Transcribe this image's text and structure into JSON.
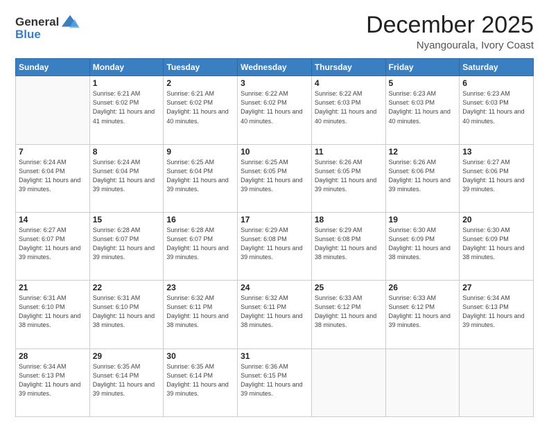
{
  "logo": {
    "general": "General",
    "blue": "Blue"
  },
  "header": {
    "month": "December 2025",
    "location": "Nyangourala, Ivory Coast"
  },
  "weekdays": [
    "Sunday",
    "Monday",
    "Tuesday",
    "Wednesday",
    "Thursday",
    "Friday",
    "Saturday"
  ],
  "weeks": [
    [
      {
        "day": "",
        "info": ""
      },
      {
        "day": "1",
        "info": "Sunrise: 6:21 AM\nSunset: 6:02 PM\nDaylight: 11 hours\nand 41 minutes."
      },
      {
        "day": "2",
        "info": "Sunrise: 6:21 AM\nSunset: 6:02 PM\nDaylight: 11 hours\nand 40 minutes."
      },
      {
        "day": "3",
        "info": "Sunrise: 6:22 AM\nSunset: 6:02 PM\nDaylight: 11 hours\nand 40 minutes."
      },
      {
        "day": "4",
        "info": "Sunrise: 6:22 AM\nSunset: 6:03 PM\nDaylight: 11 hours\nand 40 minutes."
      },
      {
        "day": "5",
        "info": "Sunrise: 6:23 AM\nSunset: 6:03 PM\nDaylight: 11 hours\nand 40 minutes."
      },
      {
        "day": "6",
        "info": "Sunrise: 6:23 AM\nSunset: 6:03 PM\nDaylight: 11 hours\nand 40 minutes."
      }
    ],
    [
      {
        "day": "7",
        "info": "Sunrise: 6:24 AM\nSunset: 6:04 PM\nDaylight: 11 hours\nand 39 minutes."
      },
      {
        "day": "8",
        "info": "Sunrise: 6:24 AM\nSunset: 6:04 PM\nDaylight: 11 hours\nand 39 minutes."
      },
      {
        "day": "9",
        "info": "Sunrise: 6:25 AM\nSunset: 6:04 PM\nDaylight: 11 hours\nand 39 minutes."
      },
      {
        "day": "10",
        "info": "Sunrise: 6:25 AM\nSunset: 6:05 PM\nDaylight: 11 hours\nand 39 minutes."
      },
      {
        "day": "11",
        "info": "Sunrise: 6:26 AM\nSunset: 6:05 PM\nDaylight: 11 hours\nand 39 minutes."
      },
      {
        "day": "12",
        "info": "Sunrise: 6:26 AM\nSunset: 6:06 PM\nDaylight: 11 hours\nand 39 minutes."
      },
      {
        "day": "13",
        "info": "Sunrise: 6:27 AM\nSunset: 6:06 PM\nDaylight: 11 hours\nand 39 minutes."
      }
    ],
    [
      {
        "day": "14",
        "info": "Sunrise: 6:27 AM\nSunset: 6:07 PM\nDaylight: 11 hours\nand 39 minutes."
      },
      {
        "day": "15",
        "info": "Sunrise: 6:28 AM\nSunset: 6:07 PM\nDaylight: 11 hours\nand 39 minutes."
      },
      {
        "day": "16",
        "info": "Sunrise: 6:28 AM\nSunset: 6:07 PM\nDaylight: 11 hours\nand 39 minutes."
      },
      {
        "day": "17",
        "info": "Sunrise: 6:29 AM\nSunset: 6:08 PM\nDaylight: 11 hours\nand 39 minutes."
      },
      {
        "day": "18",
        "info": "Sunrise: 6:29 AM\nSunset: 6:08 PM\nDaylight: 11 hours\nand 38 minutes."
      },
      {
        "day": "19",
        "info": "Sunrise: 6:30 AM\nSunset: 6:09 PM\nDaylight: 11 hours\nand 38 minutes."
      },
      {
        "day": "20",
        "info": "Sunrise: 6:30 AM\nSunset: 6:09 PM\nDaylight: 11 hours\nand 38 minutes."
      }
    ],
    [
      {
        "day": "21",
        "info": "Sunrise: 6:31 AM\nSunset: 6:10 PM\nDaylight: 11 hours\nand 38 minutes."
      },
      {
        "day": "22",
        "info": "Sunrise: 6:31 AM\nSunset: 6:10 PM\nDaylight: 11 hours\nand 38 minutes."
      },
      {
        "day": "23",
        "info": "Sunrise: 6:32 AM\nSunset: 6:11 PM\nDaylight: 11 hours\nand 38 minutes."
      },
      {
        "day": "24",
        "info": "Sunrise: 6:32 AM\nSunset: 6:11 PM\nDaylight: 11 hours\nand 38 minutes."
      },
      {
        "day": "25",
        "info": "Sunrise: 6:33 AM\nSunset: 6:12 PM\nDaylight: 11 hours\nand 38 minutes."
      },
      {
        "day": "26",
        "info": "Sunrise: 6:33 AM\nSunset: 6:12 PM\nDaylight: 11 hours\nand 39 minutes."
      },
      {
        "day": "27",
        "info": "Sunrise: 6:34 AM\nSunset: 6:13 PM\nDaylight: 11 hours\nand 39 minutes."
      }
    ],
    [
      {
        "day": "28",
        "info": "Sunrise: 6:34 AM\nSunset: 6:13 PM\nDaylight: 11 hours\nand 39 minutes."
      },
      {
        "day": "29",
        "info": "Sunrise: 6:35 AM\nSunset: 6:14 PM\nDaylight: 11 hours\nand 39 minutes."
      },
      {
        "day": "30",
        "info": "Sunrise: 6:35 AM\nSunset: 6:14 PM\nDaylight: 11 hours\nand 39 minutes."
      },
      {
        "day": "31",
        "info": "Sunrise: 6:36 AM\nSunset: 6:15 PM\nDaylight: 11 hours\nand 39 minutes."
      },
      {
        "day": "",
        "info": ""
      },
      {
        "day": "",
        "info": ""
      },
      {
        "day": "",
        "info": ""
      }
    ]
  ]
}
